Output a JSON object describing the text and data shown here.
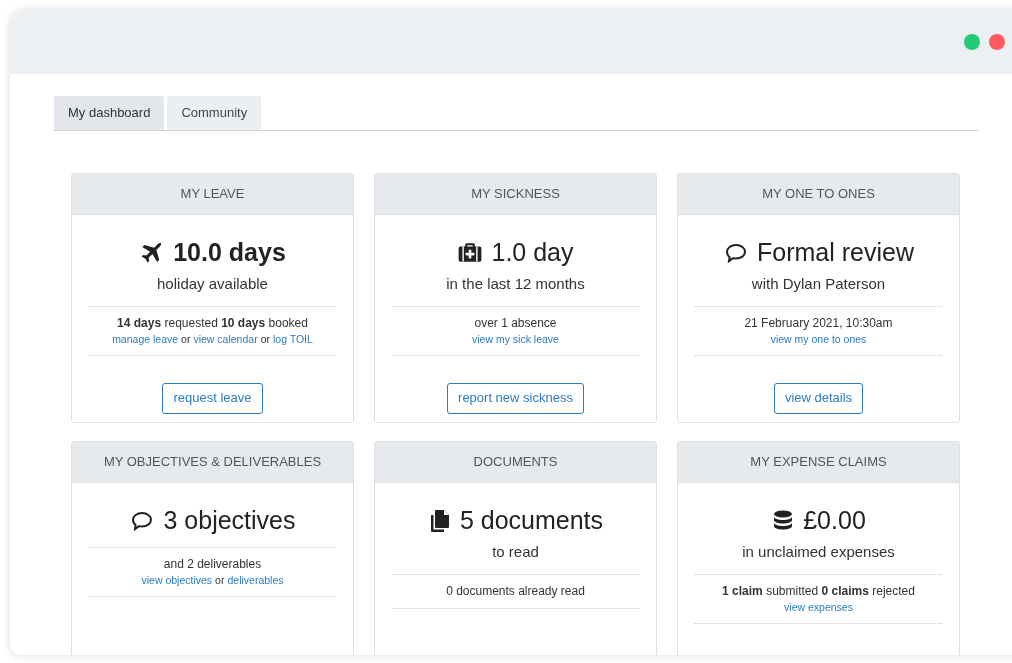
{
  "tabs": [
    {
      "label": "My dashboard",
      "selected": true
    },
    {
      "label": "Community",
      "selected": false
    }
  ],
  "cards": [
    {
      "title": "MY LEAVE",
      "kind": "plane",
      "headline": "10.0 days",
      "headline_bold": true,
      "subline": "holiday available",
      "detail": "**14 days** requested **10 days** booked",
      "links": [
        {
          "kind": "link",
          "text": "manage leave"
        },
        {
          "kind": "text",
          "text": "or"
        },
        {
          "kind": "link",
          "text": "view calendar"
        },
        {
          "kind": "text",
          "text": "or"
        },
        {
          "kind": "link",
          "text": "log TOIL"
        }
      ],
      "button": "request leave"
    },
    {
      "title": "MY SICKNESS",
      "kind": "medkit",
      "headline": "1.0 day",
      "headline_bold": false,
      "subline": "in the last 12 months",
      "detail": "over 1 absence",
      "links": [
        {
          "kind": "link",
          "text": "view my sick leave"
        }
      ],
      "button": "report new sickness"
    },
    {
      "title": "MY ONE TO ONES",
      "kind": "comment",
      "headline": "Formal review",
      "headline_bold": false,
      "subline": "with Dylan Paterson",
      "detail": "21 February 2021, 10:30am",
      "links": [
        {
          "kind": "link",
          "text": "view my one to ones"
        }
      ],
      "button": "view details"
    },
    {
      "title": "MY OBJECTIVES & DELIVERABLES",
      "kind": "comment",
      "headline": "3 objectives",
      "headline_bold": false,
      "detail": "and 2 deliverables",
      "links": [
        {
          "kind": "link",
          "text": "view objectives"
        },
        {
          "kind": "text",
          "text": "or"
        },
        {
          "kind": "link",
          "text": "deliverables"
        }
      ]
    },
    {
      "title": "DOCUMENTS",
      "kind": "copy",
      "headline": "5 documents",
      "headline_bold": false,
      "subline": "to read",
      "detail": "0 documents already read"
    },
    {
      "title": "MY EXPENSE CLAIMS",
      "kind": "database",
      "headline": "£0.00",
      "headline_bold": false,
      "subline": "in unclaimed expenses",
      "detail": "**1 claim** submitted **0 claims** rejected",
      "links": [
        {
          "kind": "link",
          "text": "view expenses"
        }
      ]
    }
  ]
}
